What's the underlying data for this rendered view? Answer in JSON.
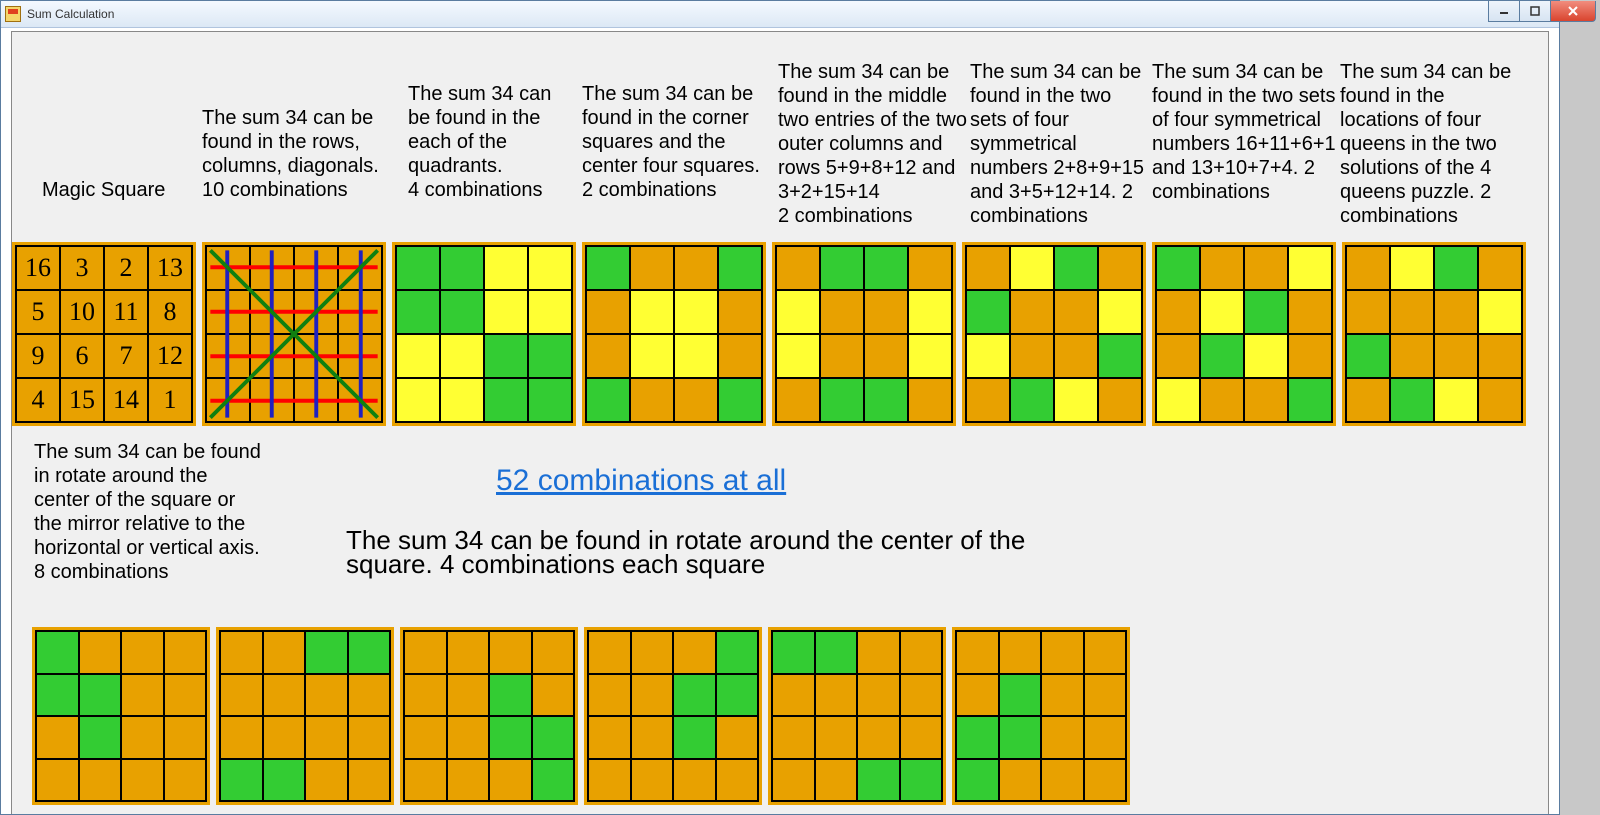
{
  "window": {
    "title": "Sum Calculation"
  },
  "row1": {
    "labels": {
      "magic": "Magic Square",
      "c2": "The sum 34 can be found in the rows, columns, diagonals.\n 10 combinations",
      "c3": "The sum 34 can be found in the each of the quadrants.\n 4 combinations",
      "c4": "The sum 34 can be found in the corner squares and the center four squares. 2 combinations",
      "c5": "The sum 34 can be found in the middle two entries of the two outer columns and rows 5+9+8+12 and 3+2+15+14\n  2 combinations",
      "c6": "The sum 34 can be found in the two sets of four symmetrical numbers 2+8+9+15 and 3+5+12+14. 2 combinations",
      "c7": "The sum 34 can be found in the two sets of four symmetrical numbers 16+11+6+1 and 13+10+7+4. 2 combinations",
      "c8": "The sum 34 can be found in the locations of four queens in the two solutions of the 4 queens puzzle. 2 combinations"
    },
    "magic_values": [
      [
        16,
        3,
        2,
        13
      ],
      [
        5,
        10,
        11,
        8
      ],
      [
        9,
        6,
        7,
        12
      ],
      [
        4,
        15,
        14,
        1
      ]
    ],
    "grids": [
      {
        "desc": "rows-cols-diagonals-lines"
      },
      {
        "desc": "quadrants",
        "cells": [
          "g",
          "g",
          "y",
          "y",
          "g",
          "g",
          "y",
          "y",
          "y",
          "y",
          "g",
          "g",
          "y",
          "y",
          "g",
          "g"
        ]
      },
      {
        "desc": "corners-center",
        "cells": [
          "g",
          "o",
          "o",
          "g",
          "o",
          "y",
          "y",
          "o",
          "o",
          "y",
          "y",
          "o",
          "g",
          "o",
          "o",
          "g"
        ]
      },
      {
        "desc": "middle-outer",
        "cells": [
          "o",
          "g",
          "g",
          "o",
          "y",
          "o",
          "o",
          "y",
          "y",
          "o",
          "o",
          "y",
          "o",
          "g",
          "g",
          "o"
        ]
      },
      {
        "desc": "sym1",
        "cells": [
          "o",
          "y",
          "g",
          "o",
          "g",
          "o",
          "o",
          "y",
          "y",
          "o",
          "o",
          "g",
          "o",
          "g",
          "y",
          "o"
        ]
      },
      {
        "desc": "sym2",
        "cells": [
          "g",
          "o",
          "o",
          "y",
          "o",
          "y",
          "g",
          "o",
          "o",
          "g",
          "y",
          "o",
          "y",
          "o",
          "o",
          "g"
        ]
      },
      {
        "desc": "queens",
        "cells": [
          "o",
          "y",
          "g",
          "o",
          "o",
          "o",
          "o",
          "y",
          "g",
          "o",
          "o",
          "o",
          "o",
          "g",
          "y",
          "o"
        ]
      }
    ]
  },
  "row2": {
    "left_label": "The sum 34 can be found in rotate around the center of the square or the mirror relative to the horizontal or vertical axis.\n8 combinations",
    "link": "52 combinations at all",
    "right_label": "The sum 34 can be found in rotate around the center of the square. 4 combinations each square",
    "grids": [
      {
        "cells": [
          "g",
          "o",
          "o",
          "o",
          "g",
          "g",
          "o",
          "o",
          "o",
          "g",
          "o",
          "o",
          "o",
          "o",
          "o",
          "o"
        ]
      },
      {
        "cells": [
          "o",
          "o",
          "g",
          "g",
          "o",
          "o",
          "o",
          "o",
          "o",
          "o",
          "o",
          "o",
          "g",
          "g",
          "o",
          "o"
        ]
      },
      {
        "cells": [
          "o",
          "o",
          "o",
          "o",
          "o",
          "o",
          "g",
          "o",
          "o",
          "o",
          "g",
          "g",
          "o",
          "o",
          "o",
          "g"
        ]
      },
      {
        "cells": [
          "o",
          "o",
          "o",
          "g",
          "o",
          "o",
          "g",
          "g",
          "o",
          "o",
          "g",
          "o",
          "o",
          "o",
          "o",
          "o"
        ]
      },
      {
        "cells": [
          "g",
          "g",
          "o",
          "o",
          "o",
          "o",
          "o",
          "o",
          "o",
          "o",
          "o",
          "o",
          "o",
          "o",
          "g",
          "g"
        ]
      },
      {
        "cells": [
          "o",
          "o",
          "o",
          "o",
          "o",
          "g",
          "o",
          "o",
          "g",
          "g",
          "o",
          "o",
          "g",
          "o",
          "o",
          "o"
        ]
      }
    ]
  }
}
